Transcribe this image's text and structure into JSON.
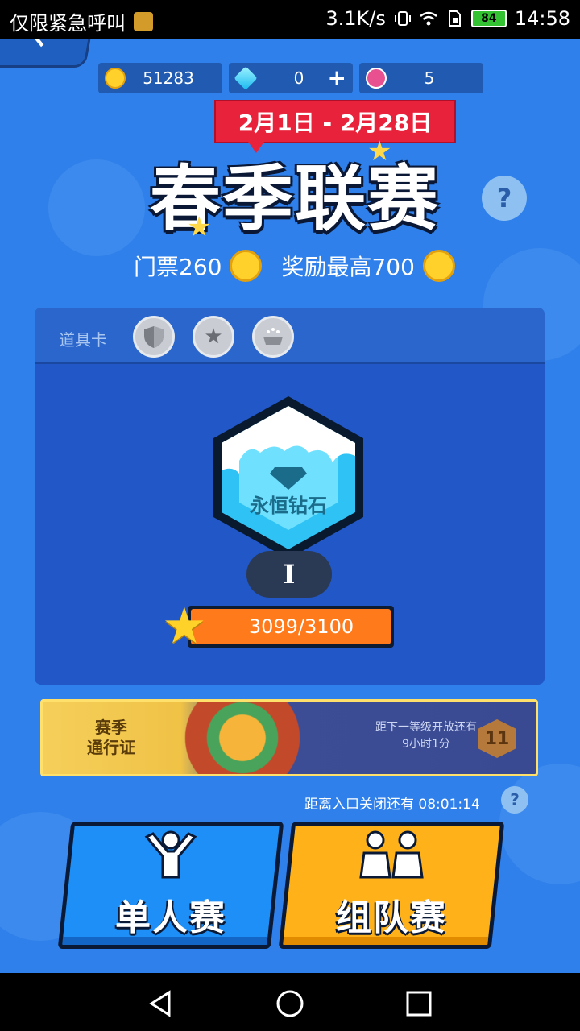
{
  "status_bar": {
    "carrier_text": "仅限紧急呼叫",
    "speed": "3.1K/s",
    "battery": "84",
    "time": "14:58"
  },
  "currency": {
    "coins": "51283",
    "gems": "0",
    "gems_add": "+",
    "lotus": "5"
  },
  "season": {
    "date_range": "2月1日 - 2月28日",
    "title": "春季联赛",
    "help": "?",
    "ticket_label": "门票260",
    "reward_label": "奖励最高700"
  },
  "props": {
    "label": "道具卡"
  },
  "rank": {
    "name": "永恒钻石",
    "level": "I",
    "progress_text": "3099/3100",
    "progress_value": 0.9997
  },
  "season_pass": {
    "title_line1": "赛季",
    "title_line2": "通行证",
    "next_level_line1": "距下一等级开放还有",
    "next_level_line2": "9小时1分",
    "badge_level": "11"
  },
  "entry": {
    "close_timer": "距离入口关闭还有 08:01:14",
    "help": "?"
  },
  "modes": {
    "single": "单人赛",
    "team": "组队赛"
  },
  "colors": {
    "background": "#2f80ea",
    "panel": "#2157c6",
    "date_banner": "#e8223a",
    "single_button": "#1e8ff7",
    "team_button": "#ffb11a",
    "progress_fill": "#ff7a1a"
  }
}
